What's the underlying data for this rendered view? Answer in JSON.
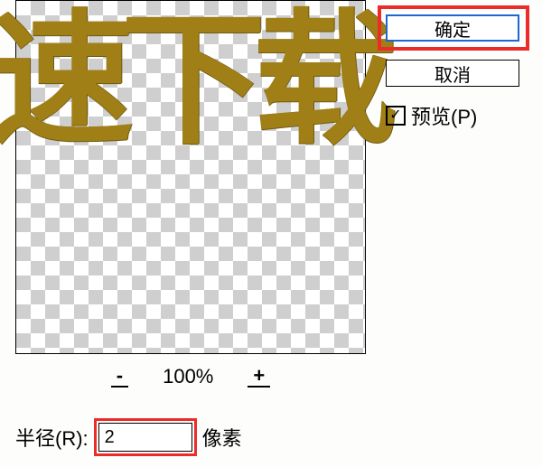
{
  "preview": {
    "sample_text": "速下载"
  },
  "zoom": {
    "minus_label": "-",
    "plus_label": "+",
    "value": "100%"
  },
  "radius": {
    "label_prefix": "半径(R):",
    "value": "2",
    "unit": "像素"
  },
  "buttons": {
    "ok": "确定",
    "cancel": "取消"
  },
  "preview_checkbox": {
    "label": "预览(P)",
    "checked_glyph": "✓"
  },
  "colors": {
    "highlight": "#ee2b2b",
    "focus": "#1e66d0",
    "text_gold": "#a07f17"
  }
}
